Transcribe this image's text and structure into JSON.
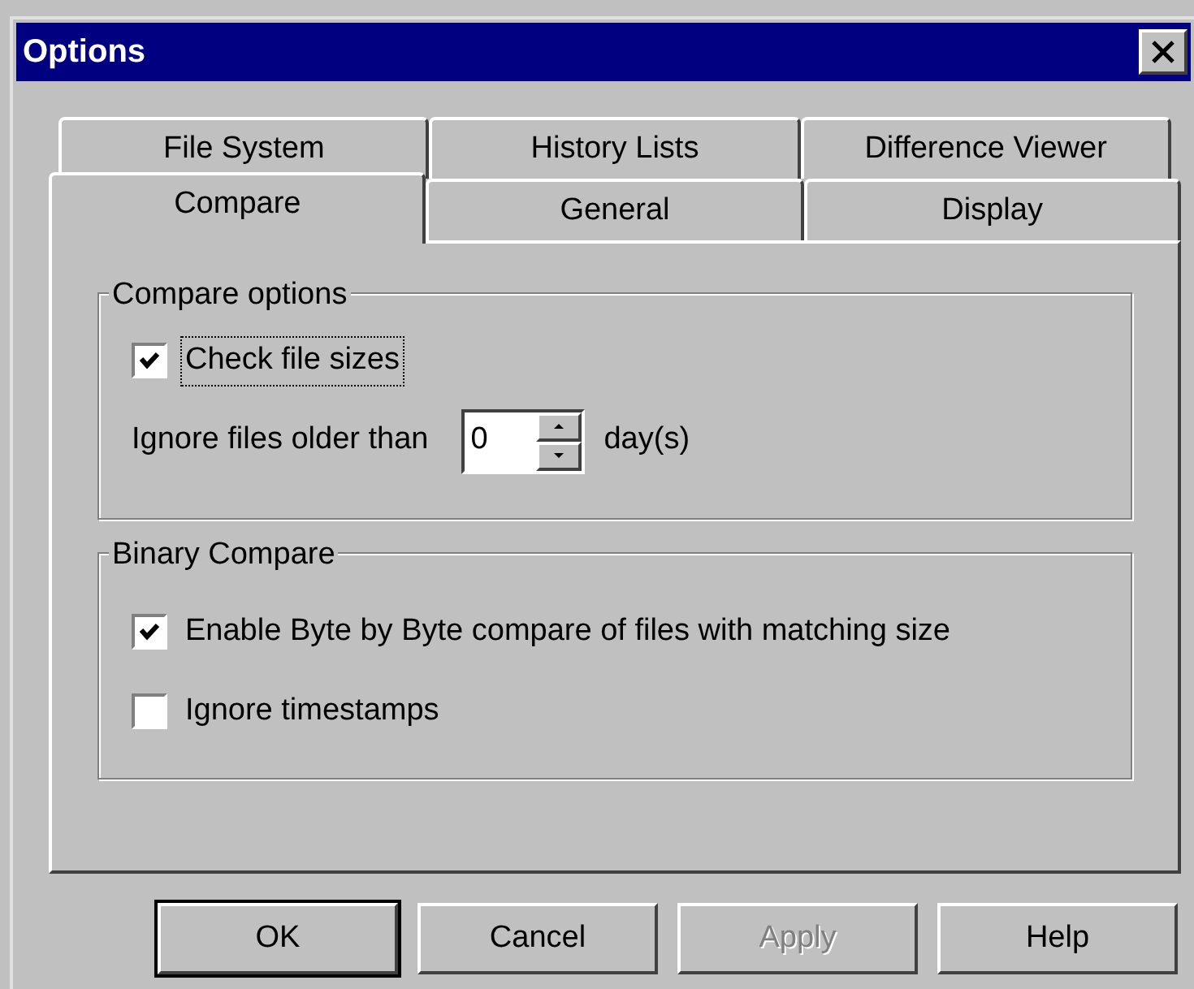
{
  "window": {
    "title": "Options"
  },
  "tab_rows": [
    [
      {
        "label": "File System",
        "selected": false
      },
      {
        "label": "History Lists",
        "selected": false
      },
      {
        "label": "Difference Viewer",
        "selected": false
      }
    ],
    [
      {
        "label": "Compare",
        "selected": true
      },
      {
        "label": "General",
        "selected": false
      },
      {
        "label": "Display",
        "selected": false
      }
    ]
  ],
  "compare_options": {
    "title": "Compare options",
    "check_file_sizes": {
      "label": "Check file sizes",
      "checked": true,
      "focused": true
    },
    "ignore_older": {
      "label": "Ignore files older than",
      "value": "0",
      "unit": "day(s)"
    }
  },
  "binary_compare": {
    "title": "Binary Compare",
    "options": [
      {
        "label": "Enable Byte by Byte compare of files with matching size",
        "checked": true
      },
      {
        "label": "Ignore timestamps",
        "checked": false
      }
    ]
  },
  "buttons": [
    {
      "label": "OK",
      "default": true,
      "disabled": false
    },
    {
      "label": "Cancel",
      "default": false,
      "disabled": false
    },
    {
      "label": "Apply",
      "default": false,
      "disabled": true
    },
    {
      "label": "Help",
      "default": false,
      "disabled": false
    }
  ]
}
